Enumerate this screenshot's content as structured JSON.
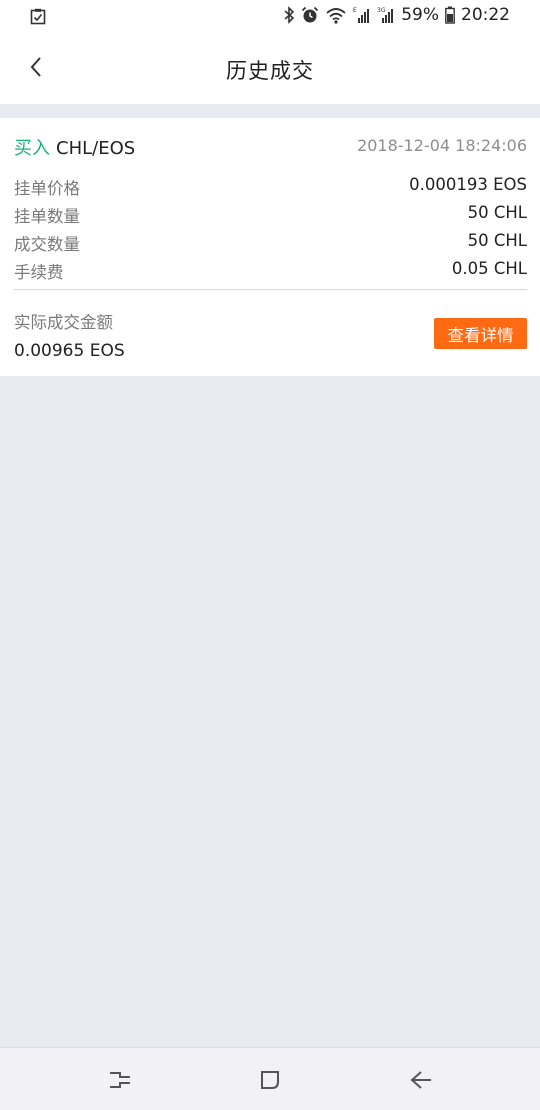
{
  "status_bar": {
    "battery": "59%",
    "time": "20:22",
    "icons": [
      "checklist-icon",
      "bluetooth-icon",
      "alarm-icon",
      "wifi-icon",
      "signal-icon",
      "signal-3g-icon",
      "battery-icon"
    ]
  },
  "header": {
    "title": "历史成交",
    "back_icon": "chevron-left-icon"
  },
  "trade": {
    "side": "买入",
    "pair": "CHL/EOS",
    "time": "2018-12-04 18:24:06",
    "side_color": "#19b37a",
    "rows": [
      {
        "label": "挂单价格",
        "value": "0.000193 EOS"
      },
      {
        "label": "挂单数量",
        "value": "50 CHL"
      },
      {
        "label": "成交数量",
        "value": "50 CHL"
      },
      {
        "label": "手续费",
        "value": "0.05 CHL"
      }
    ],
    "total_label": "实际成交金额",
    "total_value": "0.00965 EOS",
    "detail_button": "查看详情",
    "detail_button_color": "#ff6a13"
  },
  "nav_bar": {
    "icons": [
      "recent-apps-icon",
      "home-icon",
      "back-icon"
    ]
  }
}
